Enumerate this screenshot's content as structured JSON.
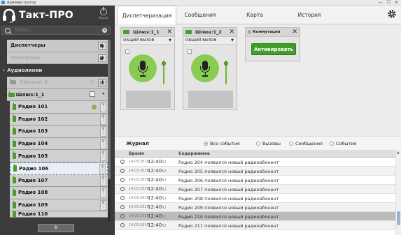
{
  "window": {
    "title": "Администратор",
    "controls": [
      "—",
      "☐",
      "✕"
    ]
  },
  "app": {
    "name": "Такт-ПРО",
    "power_label": "Выход"
  },
  "search": {
    "placeholder": "Поиск..."
  },
  "tree": {
    "dispatchers": "Диспетчеры",
    "phones": "Телефоны",
    "audiolines": "Аудиолинии",
    "channel": "Channel_0",
    "gateway": "Шлюз:1_1",
    "radios": [
      "Радио 101",
      "Радио 102",
      "Радио 103",
      "Радио 104",
      "Радио 105",
      "Радио 106",
      "Радио 107",
      "Радио 108",
      "Радио 109",
      "Радио 110"
    ],
    "selected_radio": "Радио 106"
  },
  "add_button": "+",
  "tabs": [
    "Диспетчеризация",
    "Сообщения",
    "Карта",
    "История"
  ],
  "panels": {
    "gw1": {
      "title": "Шлюз:1_1",
      "mode": "ОБЩИЙ ВЫЗОВ"
    },
    "gw2": {
      "title": "Шлюз:1_2",
      "mode": "ОБЩИЙ ВЫЗОВ"
    },
    "kom": {
      "title": "Коммутация",
      "button": "Активировать"
    }
  },
  "journal": {
    "title": "Журнал",
    "filters": [
      "Все события",
      "Вызовы",
      "Сообщения",
      "События"
    ],
    "selected_filter": "Все события",
    "columns": {
      "time": "Время",
      "content": "Содержимое"
    },
    "rows": [
      {
        "date": "14.03.2016",
        "time": "12:40",
        "sec": "52",
        "msg": "Радио 204  появился новый радиоабонент"
      },
      {
        "date": "14.03.2016",
        "time": "12:40",
        "sec": "52",
        "msg": "Радио 205  появился новый радиоабонент"
      },
      {
        "date": "14.03.2016",
        "time": "12:40",
        "sec": "52",
        "msg": "Радио 206  появился новый радиоабонент"
      },
      {
        "date": "14.03.2016",
        "time": "12:40",
        "sec": "52",
        "msg": "Радио 207  появился новый радиоабонент"
      },
      {
        "date": "14.03.2016",
        "time": "12:40",
        "sec": "52",
        "msg": "Радио 208  появился новый радиоабонент"
      },
      {
        "date": "14.03.2016",
        "time": "12:40",
        "sec": "52",
        "msg": "Радио 209  появился новый радиоабонент"
      },
      {
        "date": "14.03.2016",
        "time": "12:40",
        "sec": "52",
        "msg": "Радио 210  появился новый радиоабонент"
      },
      {
        "date": "14.03.2016",
        "time": "12:40",
        "sec": "52",
        "msg": "Радио 211  появился новый радиоабонент"
      }
    ],
    "highlighted_row": 6
  },
  "colors": {
    "accent": "#3f9d28",
    "mic": "#8acc53",
    "sidebar": "#3b3b3b"
  }
}
